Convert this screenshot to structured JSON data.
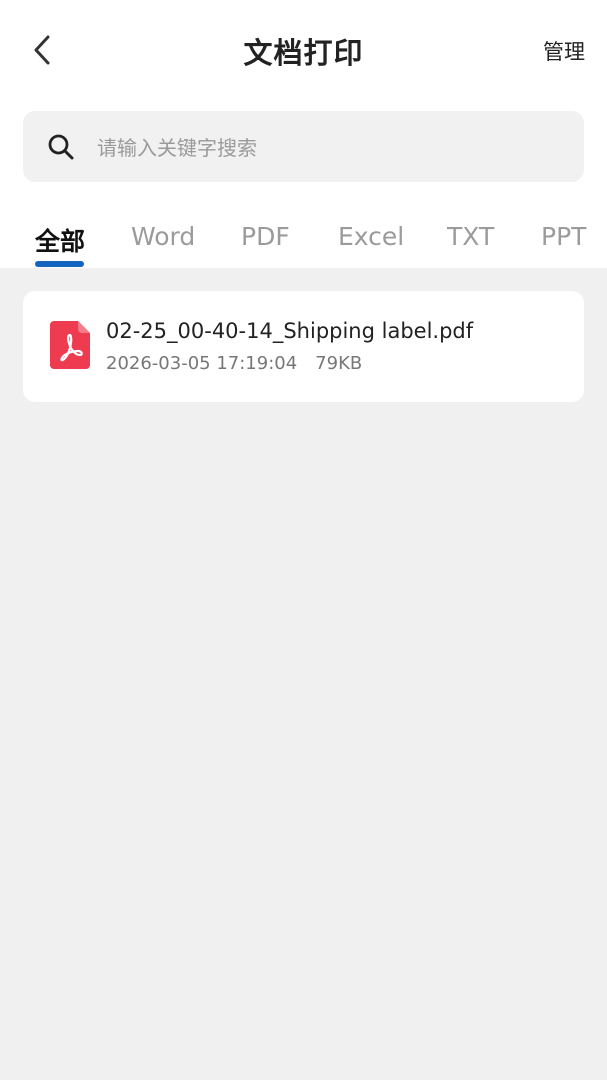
{
  "header": {
    "title": "文档打印",
    "manage_label": "管理"
  },
  "search": {
    "placeholder": "请输入关键字搜索"
  },
  "tabs": [
    {
      "label": "全部",
      "active": true
    },
    {
      "label": "Word",
      "active": false
    },
    {
      "label": "PDF",
      "active": false
    },
    {
      "label": "Excel",
      "active": false
    },
    {
      "label": "TXT",
      "active": false
    },
    {
      "label": "PPT",
      "active": false
    }
  ],
  "files": [
    {
      "name": "02-25_00-40-14_Shipping label.pdf",
      "date": "2026-03-05 17:19:04",
      "size": "79KB",
      "icon": "pdf-file-icon"
    }
  ],
  "colors": {
    "accent": "#1565c0",
    "pdf_icon": "#ee3b4f",
    "background": "#f0f0f0"
  }
}
